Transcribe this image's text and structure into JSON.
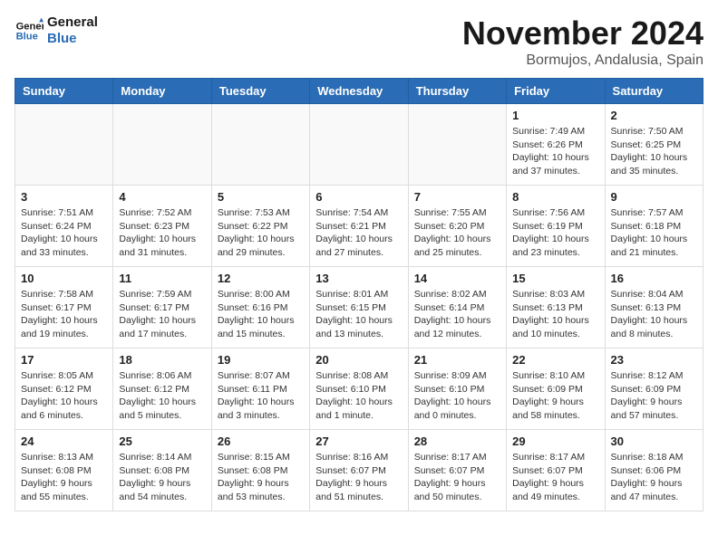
{
  "header": {
    "logo_line1": "General",
    "logo_line2": "Blue",
    "month_title": "November 2024",
    "subtitle": "Bormujos, Andalusia, Spain"
  },
  "weekdays": [
    "Sunday",
    "Monday",
    "Tuesday",
    "Wednesday",
    "Thursday",
    "Friday",
    "Saturday"
  ],
  "weeks": [
    [
      {
        "day": "",
        "info": ""
      },
      {
        "day": "",
        "info": ""
      },
      {
        "day": "",
        "info": ""
      },
      {
        "day": "",
        "info": ""
      },
      {
        "day": "",
        "info": ""
      },
      {
        "day": "1",
        "info": "Sunrise: 7:49 AM\nSunset: 6:26 PM\nDaylight: 10 hours\nand 37 minutes."
      },
      {
        "day": "2",
        "info": "Sunrise: 7:50 AM\nSunset: 6:25 PM\nDaylight: 10 hours\nand 35 minutes."
      }
    ],
    [
      {
        "day": "3",
        "info": "Sunrise: 7:51 AM\nSunset: 6:24 PM\nDaylight: 10 hours\nand 33 minutes."
      },
      {
        "day": "4",
        "info": "Sunrise: 7:52 AM\nSunset: 6:23 PM\nDaylight: 10 hours\nand 31 minutes."
      },
      {
        "day": "5",
        "info": "Sunrise: 7:53 AM\nSunset: 6:22 PM\nDaylight: 10 hours\nand 29 minutes."
      },
      {
        "day": "6",
        "info": "Sunrise: 7:54 AM\nSunset: 6:21 PM\nDaylight: 10 hours\nand 27 minutes."
      },
      {
        "day": "7",
        "info": "Sunrise: 7:55 AM\nSunset: 6:20 PM\nDaylight: 10 hours\nand 25 minutes."
      },
      {
        "day": "8",
        "info": "Sunrise: 7:56 AM\nSunset: 6:19 PM\nDaylight: 10 hours\nand 23 minutes."
      },
      {
        "day": "9",
        "info": "Sunrise: 7:57 AM\nSunset: 6:18 PM\nDaylight: 10 hours\nand 21 minutes."
      }
    ],
    [
      {
        "day": "10",
        "info": "Sunrise: 7:58 AM\nSunset: 6:17 PM\nDaylight: 10 hours\nand 19 minutes."
      },
      {
        "day": "11",
        "info": "Sunrise: 7:59 AM\nSunset: 6:17 PM\nDaylight: 10 hours\nand 17 minutes."
      },
      {
        "day": "12",
        "info": "Sunrise: 8:00 AM\nSunset: 6:16 PM\nDaylight: 10 hours\nand 15 minutes."
      },
      {
        "day": "13",
        "info": "Sunrise: 8:01 AM\nSunset: 6:15 PM\nDaylight: 10 hours\nand 13 minutes."
      },
      {
        "day": "14",
        "info": "Sunrise: 8:02 AM\nSunset: 6:14 PM\nDaylight: 10 hours\nand 12 minutes."
      },
      {
        "day": "15",
        "info": "Sunrise: 8:03 AM\nSunset: 6:13 PM\nDaylight: 10 hours\nand 10 minutes."
      },
      {
        "day": "16",
        "info": "Sunrise: 8:04 AM\nSunset: 6:13 PM\nDaylight: 10 hours\nand 8 minutes."
      }
    ],
    [
      {
        "day": "17",
        "info": "Sunrise: 8:05 AM\nSunset: 6:12 PM\nDaylight: 10 hours\nand 6 minutes."
      },
      {
        "day": "18",
        "info": "Sunrise: 8:06 AM\nSunset: 6:12 PM\nDaylight: 10 hours\nand 5 minutes."
      },
      {
        "day": "19",
        "info": "Sunrise: 8:07 AM\nSunset: 6:11 PM\nDaylight: 10 hours\nand 3 minutes."
      },
      {
        "day": "20",
        "info": "Sunrise: 8:08 AM\nSunset: 6:10 PM\nDaylight: 10 hours\nand 1 minute."
      },
      {
        "day": "21",
        "info": "Sunrise: 8:09 AM\nSunset: 6:10 PM\nDaylight: 10 hours\nand 0 minutes."
      },
      {
        "day": "22",
        "info": "Sunrise: 8:10 AM\nSunset: 6:09 PM\nDaylight: 9 hours\nand 58 minutes."
      },
      {
        "day": "23",
        "info": "Sunrise: 8:12 AM\nSunset: 6:09 PM\nDaylight: 9 hours\nand 57 minutes."
      }
    ],
    [
      {
        "day": "24",
        "info": "Sunrise: 8:13 AM\nSunset: 6:08 PM\nDaylight: 9 hours\nand 55 minutes."
      },
      {
        "day": "25",
        "info": "Sunrise: 8:14 AM\nSunset: 6:08 PM\nDaylight: 9 hours\nand 54 minutes."
      },
      {
        "day": "26",
        "info": "Sunrise: 8:15 AM\nSunset: 6:08 PM\nDaylight: 9 hours\nand 53 minutes."
      },
      {
        "day": "27",
        "info": "Sunrise: 8:16 AM\nSunset: 6:07 PM\nDaylight: 9 hours\nand 51 minutes."
      },
      {
        "day": "28",
        "info": "Sunrise: 8:17 AM\nSunset: 6:07 PM\nDaylight: 9 hours\nand 50 minutes."
      },
      {
        "day": "29",
        "info": "Sunrise: 8:17 AM\nSunset: 6:07 PM\nDaylight: 9 hours\nand 49 minutes."
      },
      {
        "day": "30",
        "info": "Sunrise: 8:18 AM\nSunset: 6:06 PM\nDaylight: 9 hours\nand 47 minutes."
      }
    ]
  ]
}
